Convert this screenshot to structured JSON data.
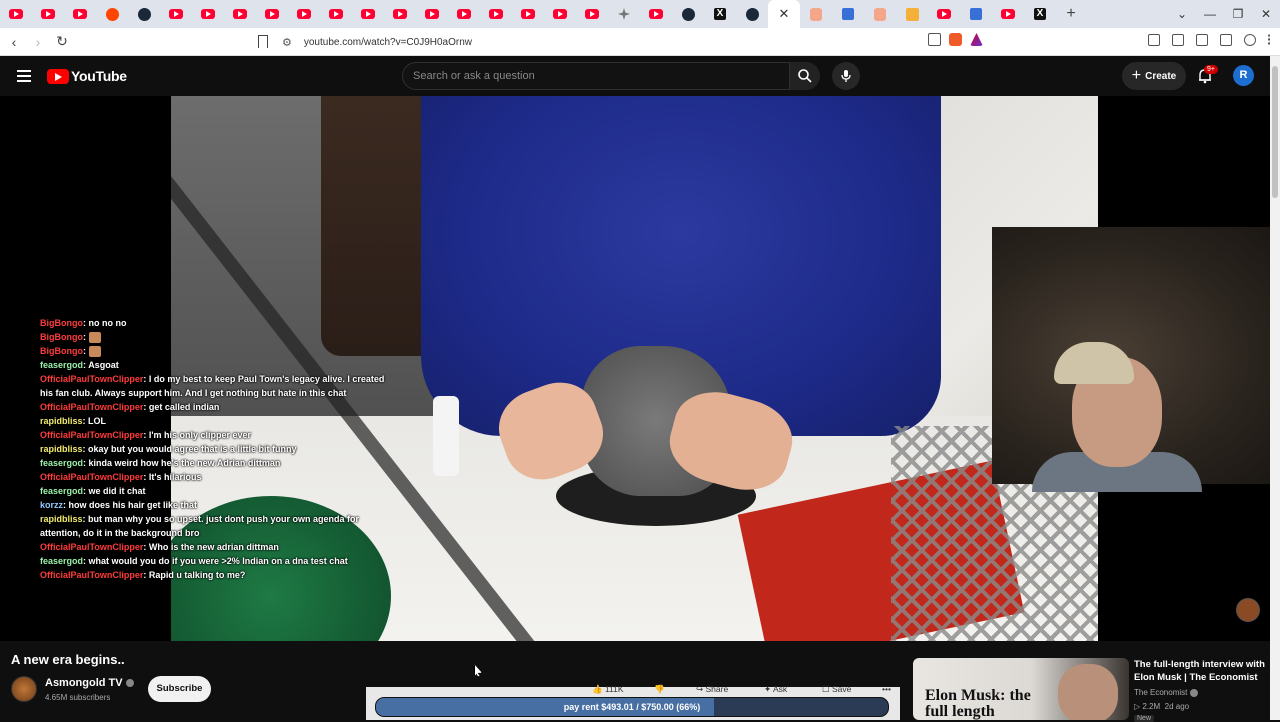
{
  "browser": {
    "tabs": [
      "yt",
      "yt",
      "yt",
      "reddit",
      "steam",
      "yt",
      "yt",
      "yt",
      "yt",
      "yt",
      "yt",
      "yt",
      "yt",
      "yt",
      "yt",
      "yt",
      "yt",
      "yt",
      "yt",
      "star",
      "yt",
      "steam",
      "x",
      "steam",
      "active",
      "brave",
      "gen",
      "brave",
      "orange",
      "yt",
      "gen",
      "yt",
      "x"
    ],
    "url": "youtube.com/watch?v=C0J9H0aOrnw",
    "new_tab": "+",
    "window_controls": [
      "⌄",
      "—",
      "❐",
      "✕"
    ]
  },
  "header": {
    "logo_text": "YouTube",
    "search_placeholder": "Search or ask a question",
    "create_label": "Create",
    "notifications_badge": "9+",
    "avatar_letter": "R"
  },
  "chat": [
    {
      "user": "BigBongo",
      "msg": "no no no",
      "color": "red"
    },
    {
      "user": "BigBongo",
      "msg": "",
      "color": "red",
      "emote": true
    },
    {
      "user": "BigBongo",
      "msg": "",
      "color": "red",
      "emote": true
    },
    {
      "user": "feasergod",
      "msg": "Asgoat",
      "color": "green"
    },
    {
      "user": "OfficialPaulTownClipper",
      "msg": "I do my best to keep Paul Town's legacy alive. I created his fan club. Always support him. And I get nothing but hate in this chat",
      "color": "red"
    },
    {
      "user": "OfficialPaulTownClipper",
      "msg": "get called indian",
      "color": "red"
    },
    {
      "user": "rapidbliss",
      "msg": "LOL",
      "color": "yellow"
    },
    {
      "user": "OfficialPaulTownClipper",
      "msg": "I'm his only clipper ever",
      "color": "red"
    },
    {
      "user": "rapidbliss",
      "msg": "okay but you would agree that is a little bit funny",
      "color": "yellow"
    },
    {
      "user": "feasergod",
      "msg": "kinda weird how he's the new Adrian dittman",
      "color": "green"
    },
    {
      "user": "OfficialPaulTownClipper",
      "msg": "It's hilarious",
      "color": "red"
    },
    {
      "user": "feasergod",
      "msg": "we did it chat",
      "color": "green"
    },
    {
      "user": "korzz",
      "msg": "how does his hair get like that",
      "color": "blue"
    },
    {
      "user": "rapidbliss",
      "msg": "but man why you so upset. just dont push your own agenda for attention, do it in the background bro",
      "color": "yellow"
    },
    {
      "user": "OfficialPaulTownClipper",
      "msg": "Who is the new adrian dittman",
      "color": "red"
    },
    {
      "user": "feasergod",
      "msg": "what would you do if you were >2% Indian on a dna test chat",
      "color": "green"
    },
    {
      "user": "OfficialPaulTownClipper",
      "msg": "Rapid u talking to me?",
      "color": "red"
    }
  ],
  "video": {
    "title": "A new era begins..",
    "channel": "Asmongold TV",
    "subscribers": "4.65M subscribers",
    "subscribe_label": "Subscribe"
  },
  "actions": {
    "likes": "111K",
    "share": "Share",
    "ask": "Ask",
    "save": "Save",
    "more": "•••"
  },
  "goal": {
    "text": "pay rent $493.01 / $750.00 (66%)",
    "fraction": 0.66
  },
  "recommendation": {
    "thumb_text": "Elon Musk: the full length",
    "title": "The full-length interview with Elon Musk | The Economist",
    "channel": "The Economist",
    "views": "2.2M",
    "age": "2d ago",
    "badge": "New"
  }
}
